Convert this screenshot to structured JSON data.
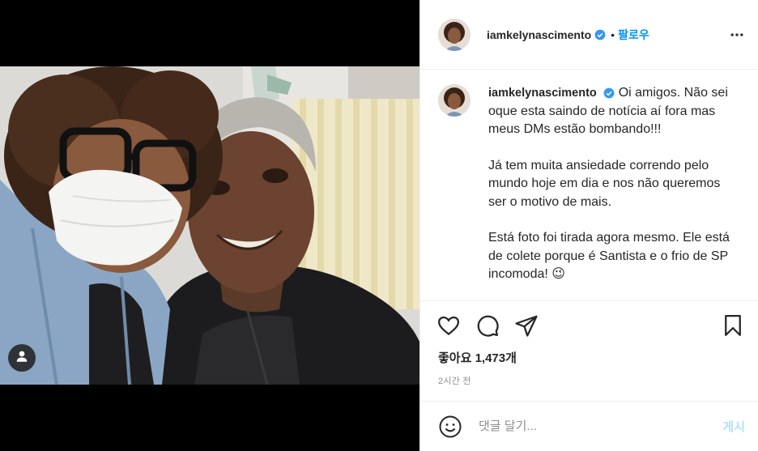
{
  "post": {
    "username": "iamkelynascimento",
    "follow_label": "팔로우",
    "separator": "•",
    "caption": {
      "username": "iamkelynascimento",
      "line1": "Oi amigos. Não sei oque esta saindo de notícia aí fora mas meus DMs estão bombando!!!",
      "line2": "Já tem muita ansiedade correndo pelo mundo hoje em dia e nos não queremos ser o motivo de mais.",
      "line3": "Está foto foi tirada agora mesmo. Ele está de colete porque é Santista e o frio de SP incomoda!",
      "emoji": "😉"
    },
    "likes_label": "좋아요 1,473개",
    "timestamp": "2시간 전"
  },
  "comment": {
    "placeholder": "댓글 달기...",
    "post_label": "게시"
  },
  "icons": {
    "verified": "verified-badge-icon",
    "more": "more-options-icon",
    "like": "heart-icon",
    "comment": "comment-icon",
    "share": "share-icon",
    "save": "bookmark-icon",
    "emoji": "emoji-icon",
    "user_tag": "user-tag-icon"
  },
  "colors": {
    "accent": "#0095f6",
    "verified": "#3897f0",
    "post_disabled": "#b2dffc"
  }
}
